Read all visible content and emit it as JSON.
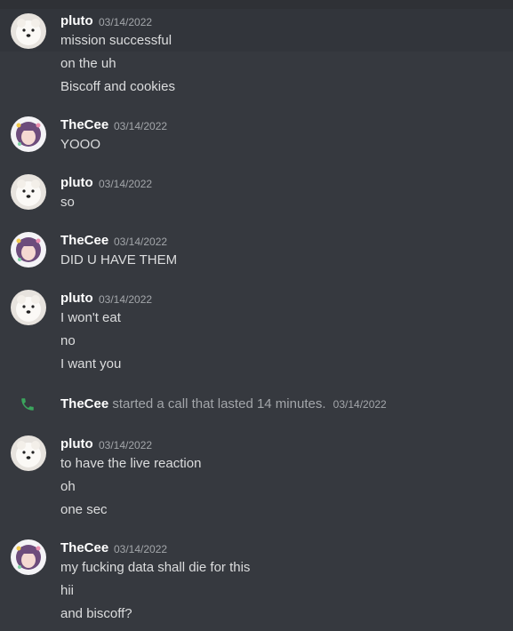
{
  "messages": [
    {
      "author": "pluto",
      "timestamp": "03/14/2022",
      "lines": [
        "mission successful",
        "on the uh",
        "Biscoff and cookies"
      ]
    },
    {
      "author": "TheCee",
      "timestamp": "03/14/2022",
      "lines": [
        "YOOO"
      ]
    },
    {
      "author": "pluto",
      "timestamp": "03/14/2022",
      "lines": [
        "so"
      ]
    },
    {
      "author": "TheCee",
      "timestamp": "03/14/2022",
      "lines": [
        "DID U HAVE THEM"
      ]
    },
    {
      "author": "pluto",
      "timestamp": "03/14/2022",
      "lines": [
        "I won't eat",
        "no",
        "I want you"
      ]
    },
    {
      "system": true,
      "icon": "phone-icon",
      "user": "TheCee",
      "text": "started a call that lasted 14 minutes.",
      "timestamp": "03/14/2022"
    },
    {
      "author": "pluto",
      "timestamp": "03/14/2022",
      "lines": [
        "to have the live reaction",
        "oh",
        "one sec"
      ]
    },
    {
      "author": "TheCee",
      "timestamp": "03/14/2022",
      "lines": [
        "my fucking data shall die for this",
        "hii",
        "and biscoff?"
      ]
    }
  ],
  "colors": {
    "background": "#36393f",
    "username": "#ffffff",
    "message_text": "#dcddde",
    "timestamp": "#a3a6aa",
    "call_icon": "#3ba55d"
  }
}
